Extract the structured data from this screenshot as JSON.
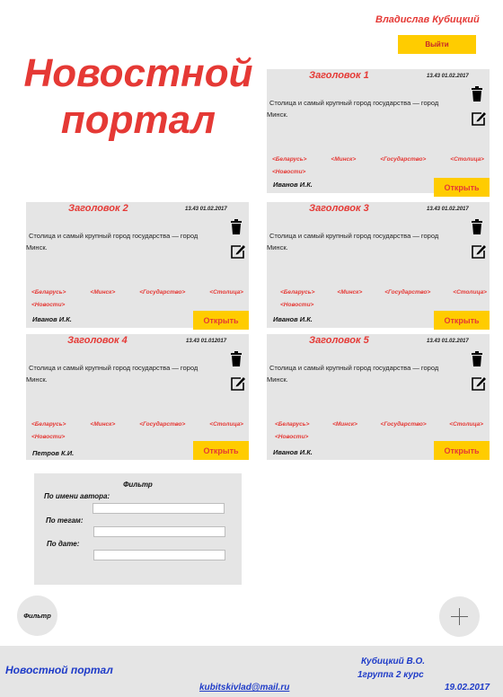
{
  "header": {
    "username": "Владислав Кубицкий",
    "logout_label": "Выйти",
    "site_title": "Новостной портал"
  },
  "cards": [
    {
      "title": "Заголовок 1",
      "date": "13.43  01.02.2017",
      "text": "Столица и самый крупный город государства — город Минск.",
      "tags": [
        "<Беларусь>",
        "<Минск>",
        "<Государство>",
        "<Столица>",
        "<Новости>"
      ],
      "author": "Иванов И.К.",
      "open_label": "Открыть"
    },
    {
      "title": "Заголовок 2",
      "date": "13.43  01.02.2017",
      "text": "Столица и самый крупный город государства — город Минск.",
      "tags": [
        "<Беларусь>",
        "<Минск>",
        "<Государство>",
        "<Столица>",
        "<Новости>"
      ],
      "author": "Иванов И.К.",
      "open_label": "Открыть"
    },
    {
      "title": "Заголовок 3",
      "date": "13.43  01.02.2017",
      "text": "Столица и самый крупный город государства — город Минск.",
      "tags": [
        "<Беларусь>",
        "<Минск>",
        "<Государство>",
        "<Столица>",
        "<Новости>"
      ],
      "author": "Иванов И.К.",
      "open_label": "Открыть"
    },
    {
      "title": "Заголовок 4",
      "date": "13.43  01.012017",
      "text": "Столица и самый крупный город государства — город Минск.",
      "tags": [
        "<Беларусь>",
        "<Минск>",
        "<Государство>",
        "<Столица>",
        "<Новости>"
      ],
      "author": "Петров К.И.",
      "open_label": "Открыть"
    },
    {
      "title": "Заголовок 5",
      "date": "13.43  01.02.2017",
      "text": "Столица и самый крупный город государства — город Минск.",
      "tags": [
        "<Беларусь>",
        "<Минск>",
        "<Государство>",
        "<Столица>",
        "<Новости>"
      ],
      "author": "Иванов И.К.",
      "open_label": "Открыть"
    }
  ],
  "filter": {
    "title": "Фильтр",
    "by_author_label": "По имени автора:",
    "by_tags_label": "По тегам:",
    "by_date_label": "По дате:",
    "author_value": "",
    "tags_value": "",
    "date_value": ""
  },
  "filter_button_label": "Фильтр",
  "icons": {
    "delete": "trash-icon",
    "edit": "edit-icon",
    "add": "plus-icon"
  },
  "colors": {
    "accent": "#e53935",
    "button_yellow": "#ffcc00",
    "card_bg": "#e5e5e5",
    "footer_text": "#1e3bc8"
  },
  "footer": {
    "brand": "Новостной портал",
    "author_name": "Кубицкий В.О.",
    "group": "1группа 2 курс",
    "email": "kubitskivlad@mail.ru",
    "date": "19.02.2017"
  }
}
